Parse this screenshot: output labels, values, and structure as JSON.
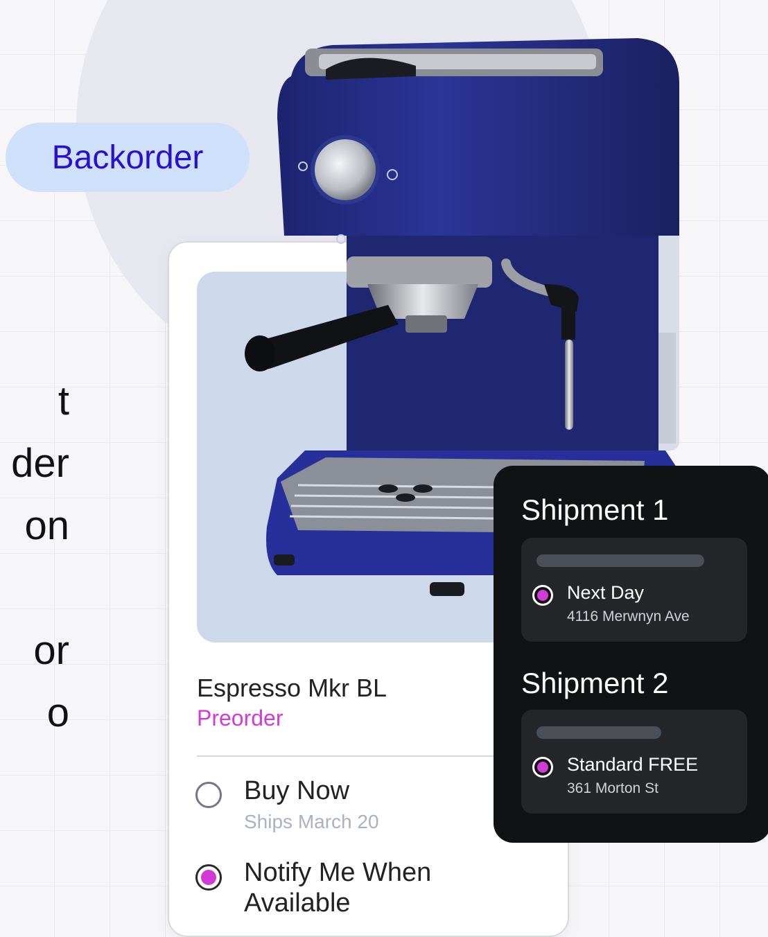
{
  "background": {
    "accent": "#e7e8ef"
  },
  "cut_text_lines": [
    "t",
    "der",
    "on",
    "",
    "or",
    "o"
  ],
  "badge": {
    "label": "Backorder",
    "bg": "#cfe0fb",
    "color": "#2b0fd0"
  },
  "product": {
    "name": "Espresso Mkr BL",
    "status": "Preorder",
    "status_color": "#d23ad6",
    "image_icon": "espresso-machine-icon",
    "options": [
      {
        "label": "Buy Now",
        "sub": "Ships March 20",
        "selected": false
      },
      {
        "label": "Notify Me When Available",
        "sub": "",
        "selected": true
      }
    ]
  },
  "shipments": [
    {
      "title": "Shipment 1",
      "method": "Next Day",
      "address": "4116 Merwnyn Ave",
      "selected": true
    },
    {
      "title": "Shipment 2",
      "method": "Standard FREE",
      "address": "361 Morton St",
      "selected": true
    }
  ]
}
